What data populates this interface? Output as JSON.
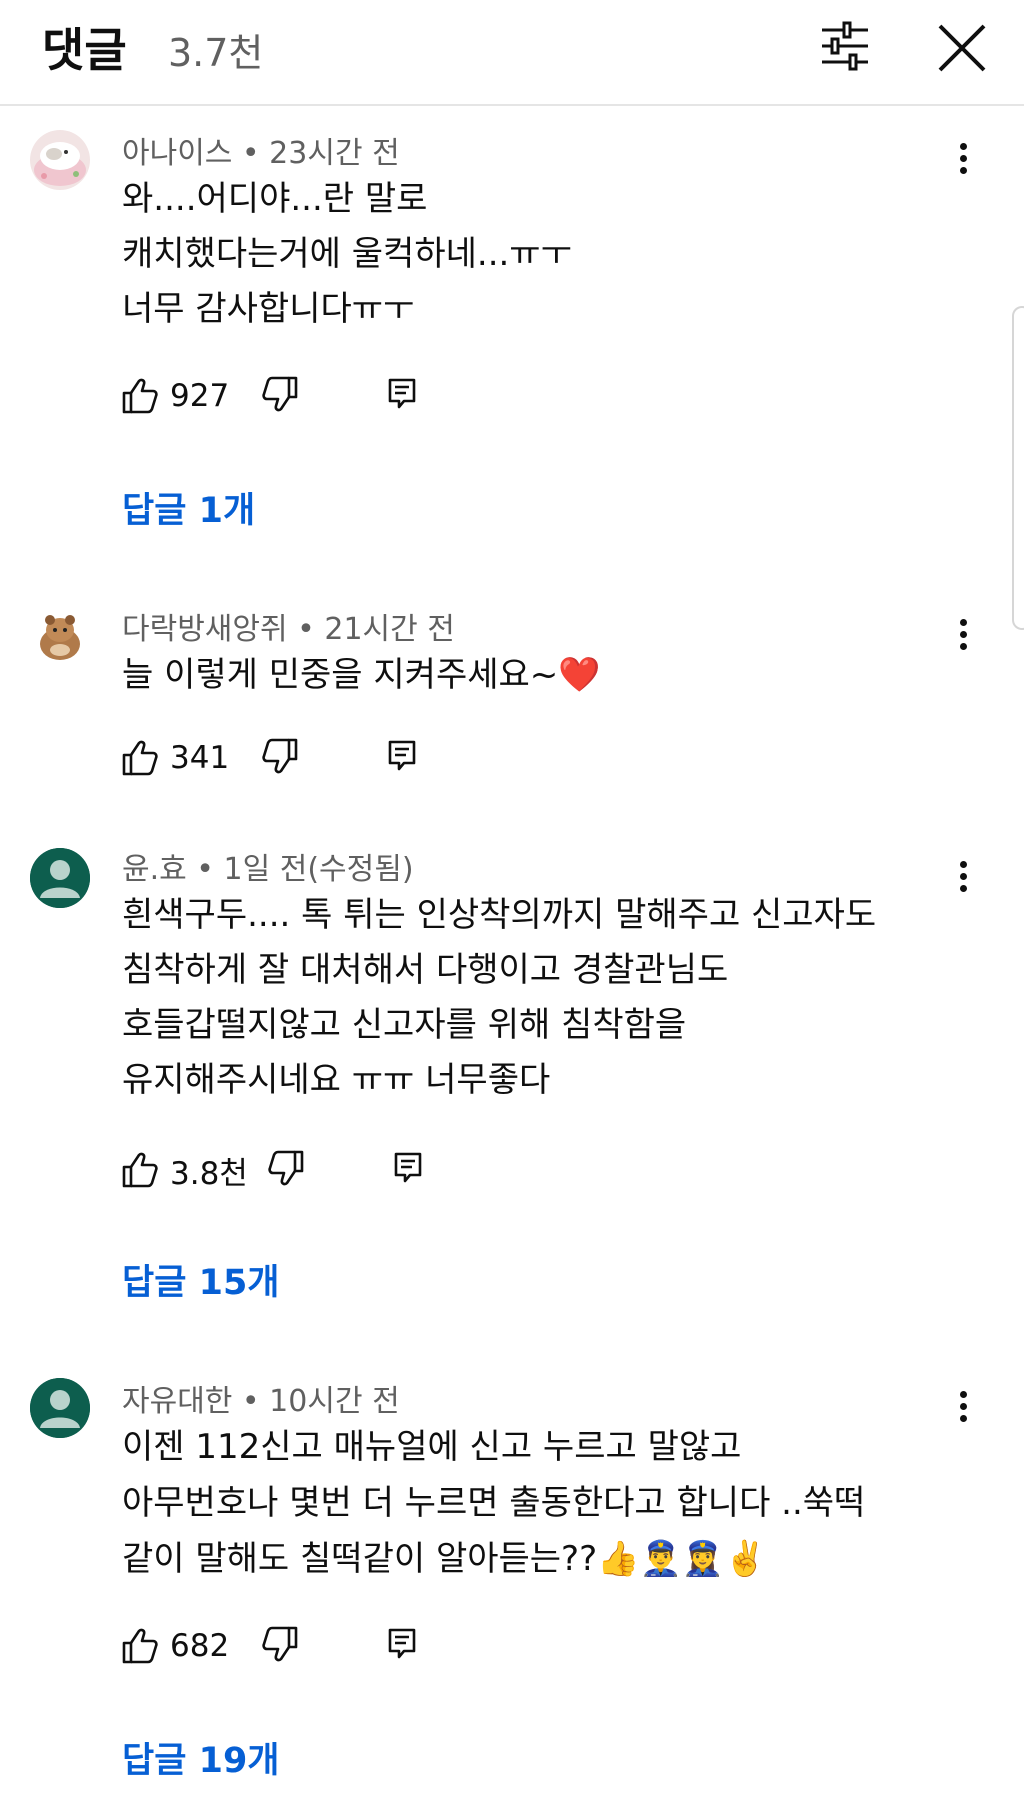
{
  "header": {
    "title": "댓글",
    "count": "3.7천"
  },
  "comments": [
    {
      "author_line": "아나이스 • 23시간 전",
      "lines": [
        "와....어디야...란 말로",
        "캐치했다는거에 울컥하네...ㅠㅜ",
        "너무 감사합니다ㅠㅜ"
      ],
      "likes": "927",
      "replies": "답글 1개",
      "avatar_icon": "hamster-photo-avatar"
    },
    {
      "author_line": "다락방새앙쥐 • 21시간 전",
      "lines": [
        "늘 이렇게 민중을 지켜주세요~❤️"
      ],
      "likes": "341",
      "avatar_icon": "hamster-photo-avatar"
    },
    {
      "author_line": "윤.효 • 1일 전(수정됨)",
      "lines": [
        "흰색구두.... 톡 튀는 인상착의까지 말해주고 신고자도",
        "침착하게 잘 대처해서 다행이고 경찰관님도",
        "호들갑떨지않고 신고자를 위해 침착함을",
        "유지해주시네요 ㅠㅠ 너무좋다"
      ],
      "likes": "3.8천",
      "replies": "답글 15개",
      "avatar_icon": "default-person-avatar"
    },
    {
      "author_line": "자유대한 • 10시간 전",
      "lines": [
        "이젠 112신고 매뉴얼에 신고 누르고 말않고",
        "아무번호나 몇번 더 누르면 출동한다고 합니다 ..쑥떡",
        "같이 말해도 칠떡같이 알아듣는??👍👮‍♂️👮‍♀️✌️"
      ],
      "likes": "682",
      "replies": "답글 19개",
      "avatar_icon": "default-person-avatar"
    }
  ],
  "colors": {
    "link": "#065fd4",
    "meta": "#606060",
    "text": "#0f0f0f",
    "avatar_default": "#0d5e4e"
  },
  "icons": [
    "filter-icon",
    "close-icon",
    "more-vert-icon",
    "thumb-up-icon",
    "thumb-down-icon",
    "reply-icon"
  ]
}
